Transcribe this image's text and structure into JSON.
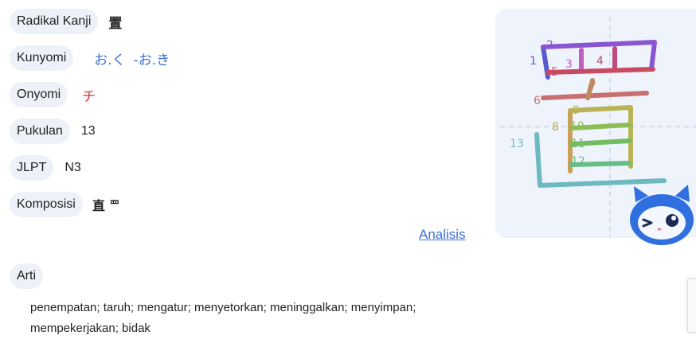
{
  "rows": {
    "radical": {
      "label": "Radikal Kanji",
      "value": "置"
    },
    "kunyomi": {
      "label": "Kunyomi",
      "values": [
        "お.く",
        "-お.き"
      ]
    },
    "onyomi": {
      "label": "Onyomi",
      "value": "チ"
    },
    "strokes": {
      "label": "Pukulan",
      "value": "13"
    },
    "jlpt": {
      "label": "JLPT",
      "value": "N3"
    },
    "composition": {
      "label": "Komposisi",
      "parts": [
        "直",
        "罒"
      ]
    }
  },
  "analysis_link": "Analisis",
  "meaning": {
    "label": "Arti",
    "text": "penempatan; taruh; mengatur; menyetorkan; meninggalkan; menyimpan; mempekerjakan; bidak"
  },
  "stroke_numbers": [
    "1",
    "2",
    "3",
    "4",
    "5",
    "6",
    "7",
    "8",
    "9",
    "10",
    "11",
    "12",
    "13"
  ],
  "colors": {
    "pill_bg": "#eef2f8",
    "link": "#3b6fd6",
    "onyomi": "#d32f2f",
    "panel_bg": "#eff4fc",
    "mascot": "#2f6fe0"
  }
}
